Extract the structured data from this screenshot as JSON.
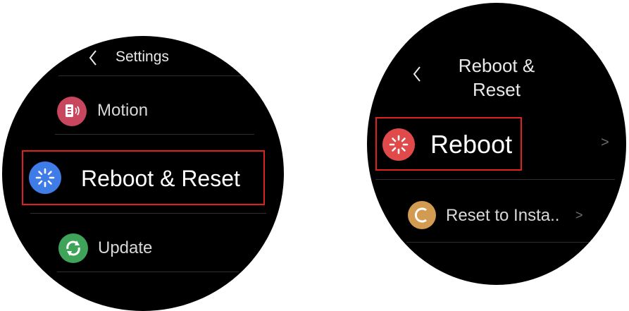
{
  "left_screen": {
    "header_title": "Settings",
    "items": [
      {
        "label": "Motion",
        "icon": "motion-icon",
        "color": "#c8465e"
      },
      {
        "label": "Reboot & Reset",
        "icon": "reboot-reset-icon",
        "color": "#3f7ce8"
      },
      {
        "label": "Update",
        "icon": "update-icon",
        "color": "#3fa35a"
      }
    ]
  },
  "right_screen": {
    "header_title_line1": "Reboot &",
    "header_title_line2": "Reset",
    "items": [
      {
        "label": "Reboot",
        "icon": "reboot-icon",
        "color": "#e04a4a",
        "chevron": ">"
      },
      {
        "label": "Reset to Insta..",
        "icon": "reset-icon",
        "color": "#d39a52",
        "chevron": ">"
      }
    ]
  },
  "highlight_color": "#e0221f"
}
